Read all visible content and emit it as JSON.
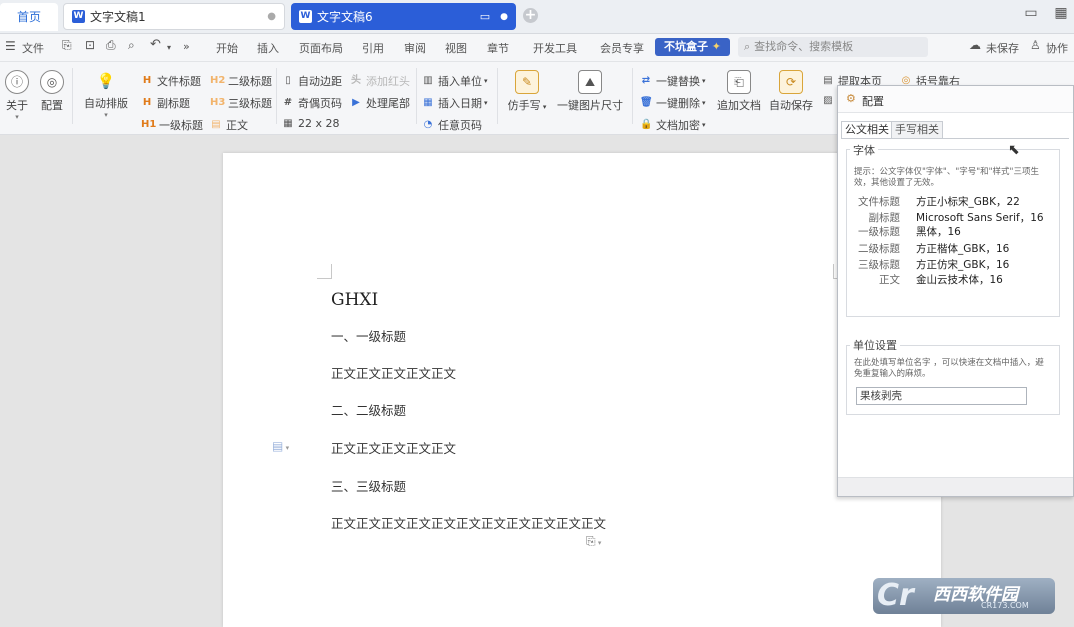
{
  "tabs": {
    "home": "首页",
    "doc1": "文字文稿1",
    "doc1_dot": "●",
    "doc2": "文字文稿6",
    "doc2_dot": "●",
    "new_tab": "+"
  },
  "menu": {
    "file": "文件",
    "more": "»",
    "items": [
      "开始",
      "插入",
      "页面布局",
      "引用",
      "审阅",
      "视图",
      "章节",
      "开发工具",
      "会员专享"
    ],
    "box": "不坑盒子",
    "search_placeholder": "查找命令、搜索模板",
    "unsaved": "未保存",
    "collab": "协作"
  },
  "ribbon": {
    "about": "关于",
    "config": "配置",
    "auto_layout": "自动排版",
    "doc_title": "文件标题",
    "sub_title": "副标题",
    "h1": "一级标题",
    "h2": "二级标题",
    "h3": "三级标题",
    "body": "正文",
    "auto_margin": "自动边距",
    "add_header": "添加红头",
    "odd_even_page": "奇偶页码",
    "handle_tail": "处理尾部",
    "grid_size": "22 x 28",
    "insert_unit": "插入单位",
    "insert_date": "插入日期",
    "any_page": "任意页码",
    "imitate_hand": "仿手写",
    "image_size": "一键图片尺寸",
    "one_replace": "一键替换",
    "one_delete": "一键删除",
    "doc_encrypt": "文档加密",
    "append_doc": "追加文档",
    "auto_save": "自动保存",
    "extract_page": "提取本页",
    "bracket_right": "括号靠右"
  },
  "document": {
    "title": "GHXI",
    "lines": [
      "一、一级标题",
      "正文正文正文正文正文",
      "二、二级标题",
      "正文正文正文正文正文",
      "三、三级标题",
      "正文正文正文正文正文正文正文正文正文正文正文"
    ]
  },
  "panel": {
    "title": "配置",
    "tab_official": "公文相关",
    "tab_hand": "手写相关",
    "font_group": "字体",
    "hint": "提示：公文字体仅\"字体\"、\"字号\"和\"样式\"三项生效，其他设置了无效。",
    "fonts": [
      {
        "key": "文件标题",
        "value": "方正小标宋_GBK，22"
      },
      {
        "key": "副标题",
        "value": "Microsoft Sans Serif，16"
      },
      {
        "key": "一级标题",
        "value": "黑体，16"
      },
      {
        "key": "二级标题",
        "value": "方正楷体_GBK，16"
      },
      {
        "key": "三级标题",
        "value": "方正仿宋_GBK，16"
      },
      {
        "key": "正文",
        "value": "金山云技术体，16"
      }
    ],
    "unit_group": "单位设置",
    "unit_hint": "在此处填写单位名字 ，可以快速在文档中插入，避免重复输入的麻烦。",
    "unit_value": "果核剥壳"
  },
  "watermark": {
    "brand": "西西软件园",
    "url": "CR173.COM"
  },
  "colors": {
    "accent": "#2b5ed8",
    "box_button": "#3a63c6",
    "heading_icon": "#e07b1a"
  }
}
